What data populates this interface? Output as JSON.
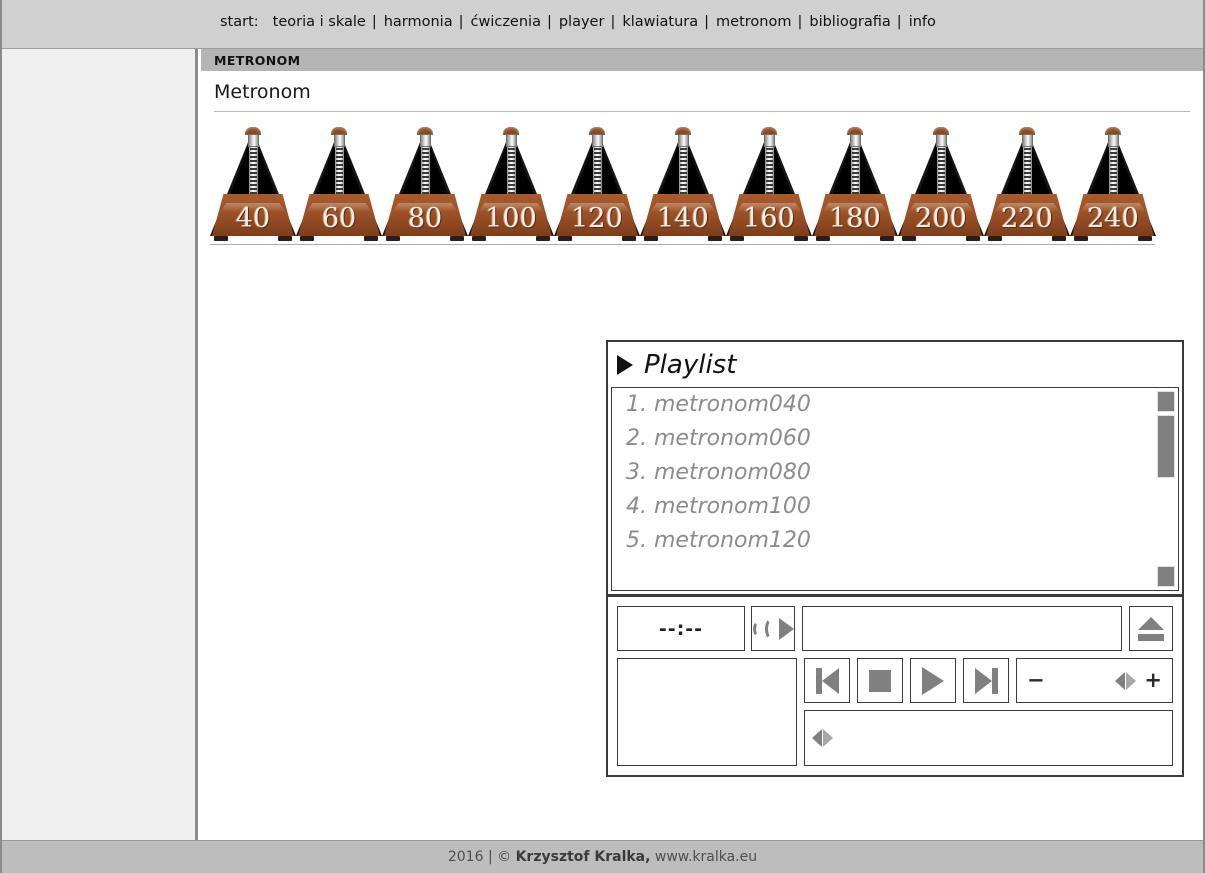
{
  "nav": {
    "start_label": "start:",
    "items": [
      {
        "label": "teoria i skale"
      },
      {
        "label": "harmonia"
      },
      {
        "label": "ćwiczenia"
      },
      {
        "label": "player"
      },
      {
        "label": "klawiatura"
      },
      {
        "label": "metronom"
      },
      {
        "label": "bibliografia"
      },
      {
        "label": "info"
      }
    ],
    "separator": "|"
  },
  "section": {
    "header": "METRONOM",
    "title": "Metronom"
  },
  "metronomes": [
    {
      "bpm": "40"
    },
    {
      "bpm": "60"
    },
    {
      "bpm": "80"
    },
    {
      "bpm": "100"
    },
    {
      "bpm": "120"
    },
    {
      "bpm": "140"
    },
    {
      "bpm": "160"
    },
    {
      "bpm": "180"
    },
    {
      "bpm": "200"
    },
    {
      "bpm": "220"
    },
    {
      "bpm": "240"
    }
  ],
  "player": {
    "playlist_title": "Playlist",
    "tracks": [
      {
        "label": "1. metronom040"
      },
      {
        "label": "2. metronom060"
      },
      {
        "label": "3. metronom080"
      },
      {
        "label": "4. metronom100"
      },
      {
        "label": "5. metronom120"
      }
    ],
    "time_display": "--:--",
    "track_title": "",
    "volume_minus": "−",
    "volume_plus": "+",
    "icons": {
      "volume": "volume-icon",
      "eject": "eject-icon",
      "previous": "previous-track-icon",
      "stop": "stop-icon",
      "play": "play-icon",
      "next": "next-track-icon"
    }
  },
  "footer": {
    "year": "2016",
    "sep": "|",
    "copy": "©",
    "author": "Krzysztof Kralka,",
    "site": "www.kralka.eu"
  },
  "colors": {
    "topbar": "#d0d0d0",
    "sidebar": "#efefef",
    "section_header": "#b5b5b5",
    "footer": "#bdbdbd",
    "metronome_wood": "#9b5026",
    "control_gray": "#808080"
  }
}
